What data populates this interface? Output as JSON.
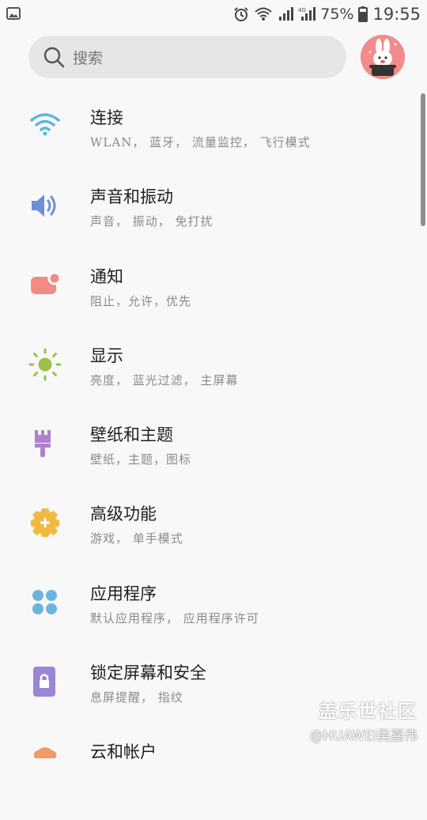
{
  "status_bar": {
    "notification_icon": "image-icon",
    "battery_percent": "75%",
    "time": "19:55",
    "network_label": "4G"
  },
  "search": {
    "placeholder": "搜索"
  },
  "avatar": {
    "icon": "bunny-avatar"
  },
  "items": [
    {
      "title": "连接",
      "subtitle": "WLAN， 蓝牙， 流量监控， 飞行模式",
      "icon": "wifi-icon",
      "color": "#5bb6e0"
    },
    {
      "title": "声音和振动",
      "subtitle": "声音， 振动， 免打扰",
      "icon": "speaker-icon",
      "color": "#6d8fd8"
    },
    {
      "title": "通知",
      "subtitle": "阻止，允许，优先",
      "icon": "notification-icon",
      "color": "#f28b84"
    },
    {
      "title": "显示",
      "subtitle": "亮度， 蓝光过滤， 主屏幕",
      "icon": "sun-icon",
      "color": "#9cc04a"
    },
    {
      "title": "壁纸和主题",
      "subtitle": "壁纸，主题，图标",
      "icon": "brush-icon",
      "color": "#b07fcf"
    },
    {
      "title": "高级功能",
      "subtitle": "游戏， 单手模式",
      "icon": "gear-plus-icon",
      "color": "#f0b940"
    },
    {
      "title": "应用程序",
      "subtitle": "默认应用程序， 应用程序许可",
      "icon": "apps-icon",
      "color": "#6ab4e0"
    },
    {
      "title": "锁定屏幕和安全",
      "subtitle": "息屏提醒， 指纹",
      "icon": "lock-icon",
      "color": "#9b86d6"
    },
    {
      "title": "云和帐户",
      "subtitle": "",
      "icon": "cloud-account-icon",
      "color": "#f29a6a"
    }
  ],
  "watermark": {
    "line1": "盖乐世社区",
    "line2": "@HUAWEI吴嘉伟"
  }
}
